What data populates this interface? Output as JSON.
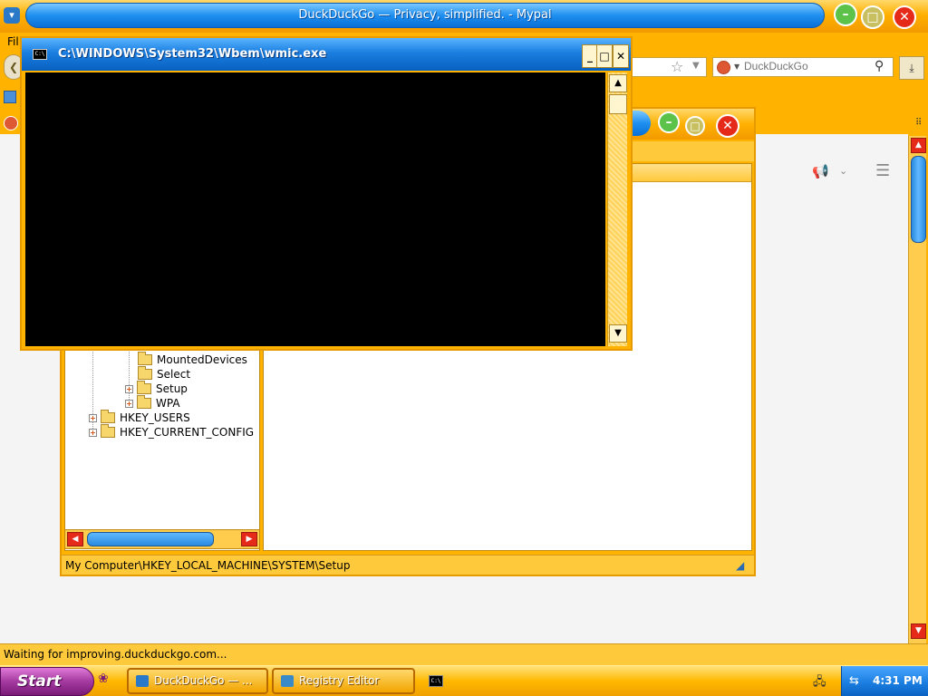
{
  "browser": {
    "title": "DuckDuckGo — Privacy, simplified. - Mypal",
    "app_icon": "mypal-icon",
    "menu_stub": "Fil",
    "search": {
      "engine_icon": "duckduckgo-icon",
      "placeholder": "DuckDuckGo"
    },
    "status_text": "Waiting for improving.duckduckgo.com...",
    "page_icons": [
      "announce-icon",
      "hamburger-icon"
    ]
  },
  "registry_editor": {
    "tree": [
      {
        "label": "MountedDevices",
        "expandable": false
      },
      {
        "label": "Select",
        "expandable": false
      },
      {
        "label": "Setup",
        "expandable": true
      },
      {
        "label": "WPA",
        "expandable": true
      },
      {
        "label": "HKEY_USERS",
        "expandable": true
      },
      {
        "label": "HKEY_CURRENT_CONFIG",
        "expandable": true
      }
    ],
    "status_path": "My Computer\\HKEY_LOCAL_MACHINE\\SYSTEM\\Setup"
  },
  "console": {
    "title": "C:\\WINDOWS\\System32\\Wbem\\wmic.exe",
    "icon_text": "C:\\",
    "buttons": {
      "minimize": "_",
      "maximize": "□",
      "close": "✕"
    }
  },
  "taskbar": {
    "start_label": "Start",
    "tasks": [
      {
        "label": "DuckDuckGo — ...",
        "icon": "mypal-icon"
      },
      {
        "label": "Registry Editor",
        "icon": "regedit-icon"
      }
    ],
    "cmd_icon_text": "C:\\",
    "clock": "4:31 PM"
  },
  "colors": {
    "theme_orange": "#ffb300",
    "title_blue": "#1a7ee0",
    "start_purple": "#a43aa0",
    "close_red": "#e52a1a"
  }
}
